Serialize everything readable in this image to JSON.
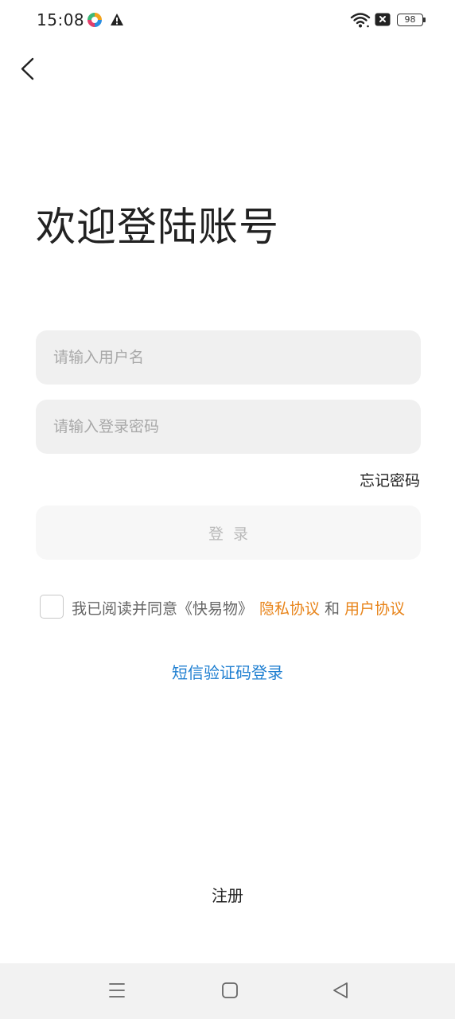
{
  "status_bar": {
    "time": "15:08",
    "battery": "98",
    "icons": [
      "app-notification-icon",
      "warning-icon",
      "wifi-icon",
      "sim-icon",
      "battery-icon"
    ]
  },
  "header": {
    "back_icon": "chevron-left-icon"
  },
  "title": "欢迎登陆账号",
  "form": {
    "username_placeholder": "请输入用户名",
    "username_value": "",
    "password_placeholder": "请输入登录密码",
    "password_value": "",
    "forgot_password": "忘记密码",
    "login_button": "登录"
  },
  "agreement": {
    "prefix": "我已阅读并同意《快易物》",
    "privacy": "隐私协议",
    "and": "和",
    "user": "用户协议",
    "checked": false
  },
  "sms_login": "短信验证码登录",
  "register": "注册",
  "nav_bar": {
    "icons": [
      "menu-icon",
      "home-icon",
      "back-triangle-icon"
    ]
  },
  "colors": {
    "accent_link": "#1f7fd1",
    "agreement_link": "#e8841a",
    "input_bg": "#f0f0f0",
    "button_disabled_bg": "#f7f7f7",
    "nav_bg": "#f2f2f2"
  }
}
